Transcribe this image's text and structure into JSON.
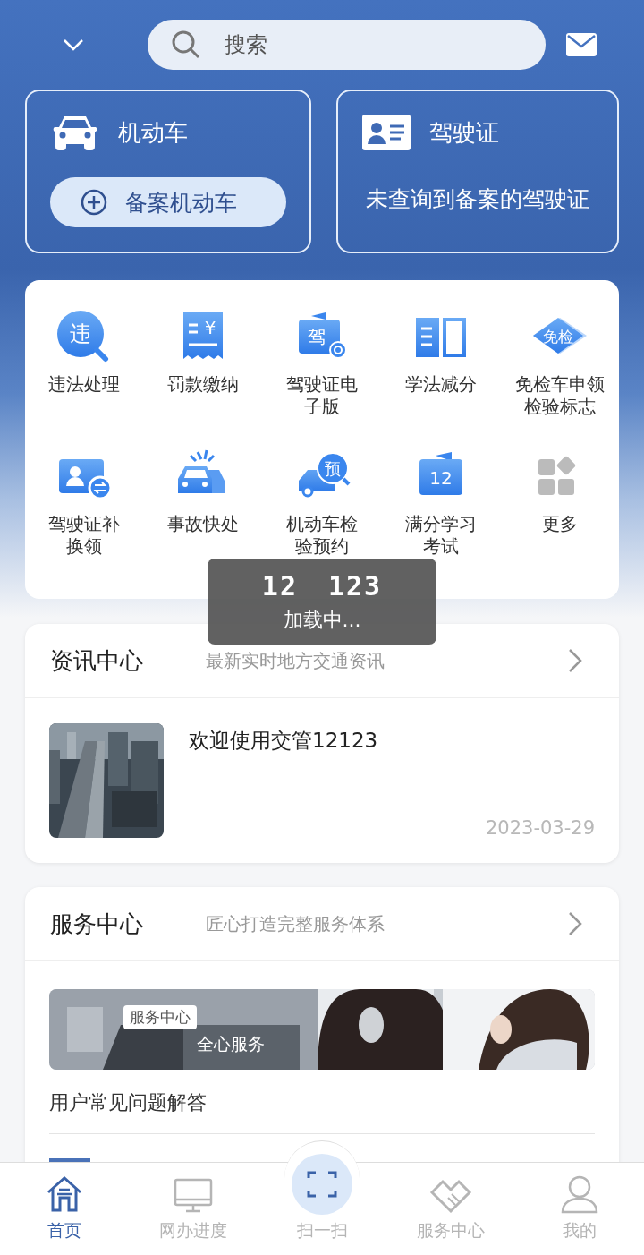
{
  "header": {
    "search_placeholder": "搜索"
  },
  "vehicle_card": {
    "title": "机动车",
    "button": "备案机动车"
  },
  "license_card": {
    "title": "驾驶证",
    "message": "未查询到备案的驾驶证"
  },
  "services": [
    {
      "label": "违法处理",
      "kind": "violation",
      "badge": "违"
    },
    {
      "label": "罚款缴纳",
      "kind": "receipt",
      "badge": "¥"
    },
    {
      "label": "驾驶证电子版",
      "kind": "elicense",
      "badge": "驾"
    },
    {
      "label": "学法减分",
      "kind": "book"
    },
    {
      "label": "免检车申领检验标志",
      "kind": "diamond",
      "badge": "免检"
    },
    {
      "label": "驾驶证补换领",
      "kind": "renew"
    },
    {
      "label": "事故快处",
      "kind": "accident"
    },
    {
      "label": "机动车检验预约",
      "kind": "booking",
      "badge": "预"
    },
    {
      "label": "满分学习考试",
      "kind": "exam",
      "badge": "12"
    },
    {
      "label": "更多",
      "kind": "more"
    }
  ],
  "loading": {
    "logo": [
      "12",
      "123"
    ],
    "message": "加载中..."
  },
  "news": {
    "title": "资讯中心",
    "subtitle": "最新实时地方交通资讯",
    "items": [
      {
        "title": "欢迎使用交管12123",
        "date": "2023-03-29"
      }
    ]
  },
  "service_center": {
    "title": "服务中心",
    "subtitle": "匠心打造完整服务体系",
    "banner": {
      "tag": "服务中心",
      "caption": "全心服务"
    },
    "items": [
      {
        "title": "用户常见问题解答"
      }
    ]
  },
  "tab_bar": [
    {
      "label": "首页",
      "kind": "home",
      "selected": true
    },
    {
      "label": "网办进度",
      "kind": "monitor",
      "selected": false
    },
    {
      "label": "扫一扫",
      "kind": "scan",
      "selected": false
    },
    {
      "label": "服务中心",
      "kind": "handshake",
      "selected": false
    },
    {
      "label": "我的",
      "kind": "person",
      "selected": false
    }
  ]
}
